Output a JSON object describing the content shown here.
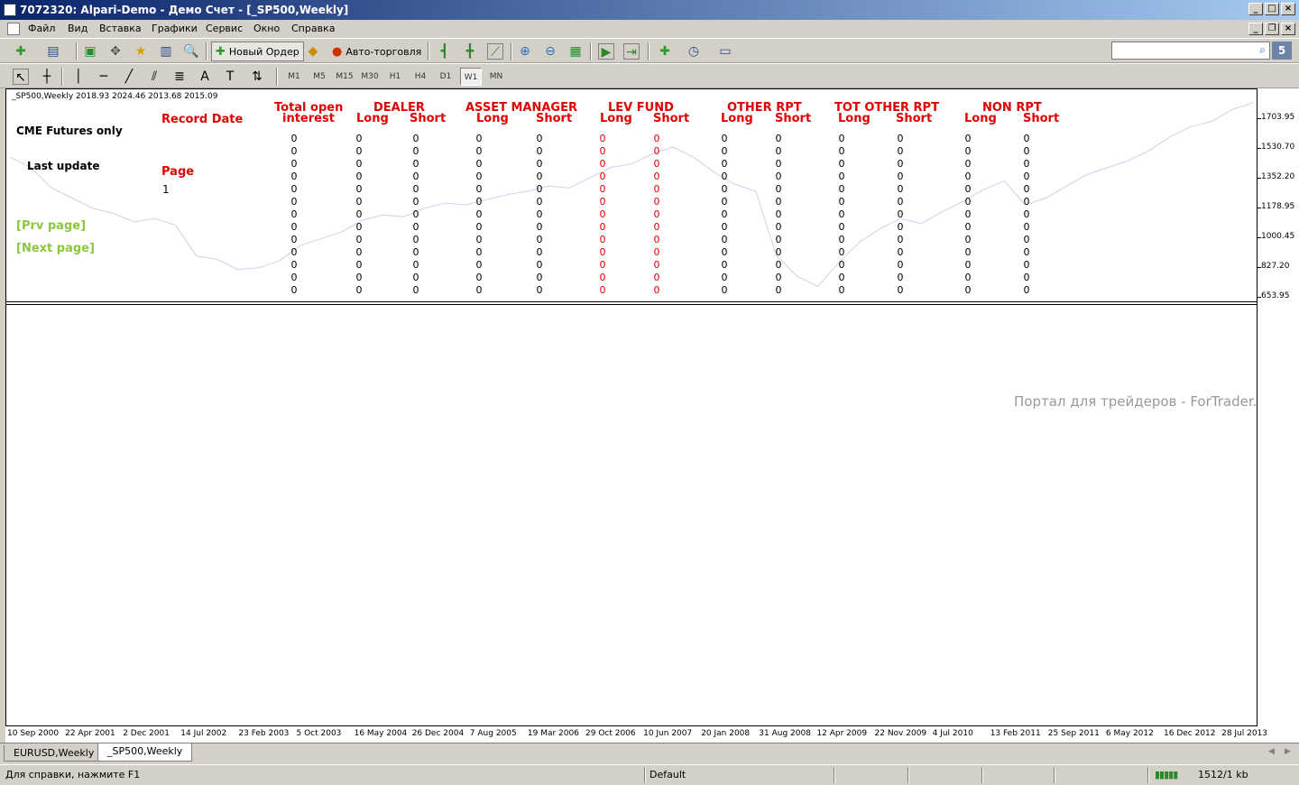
{
  "window": {
    "title": "7072320: Alpari-Demo - Демо Счет - [_SP500,Weekly]"
  },
  "menu": [
    "Файл",
    "Вид",
    "Вставка",
    "Графики",
    "Сервис",
    "Окно",
    "Справка"
  ],
  "toolbar": {
    "new_order": "Новый Ордер",
    "auto_trading": "Авто-торговля"
  },
  "periods": [
    "M1",
    "M5",
    "M15",
    "M30",
    "H1",
    "H4",
    "D1",
    "W1",
    "MN"
  ],
  "active_period": "W1",
  "chart": {
    "info": "_SP500,Weekly  2018.93 2024.46 2013.68 2015.09",
    "left_panel": {
      "source": "CME Futures only",
      "last_update": "Last update",
      "record_date": "Record  Date",
      "page_label": "Page",
      "page_value": "1",
      "prev": "[Prv page]",
      "next": "[Next page]"
    },
    "headers": {
      "total_open": "Total open",
      "interest": "interest",
      "dealer": "DEALER",
      "asset_manager": "ASSET MANAGER",
      "lev_fund": "LEV FUND",
      "other_rpt": "OTHER RPT",
      "tot_other_rpt": "TOT OTHER RPT",
      "non_rpt": "NON RPT",
      "long": "Long",
      "short": "Short"
    },
    "cell_value": "0",
    "rows": 13,
    "watermark": "Портал для трейдеров - ForTrader.ru"
  },
  "chart_data": {
    "type": "line",
    "title": "_SP500,Weekly",
    "y_ticks": [
      "1703.95",
      "1530.70",
      "1352.20",
      "1178.95",
      "1000.45",
      "827.20",
      "653.95"
    ],
    "x_ticks": [
      "10 Sep 2000",
      "22 Apr 2001",
      "2 Dec 2001",
      "14 Jul 2002",
      "23 Feb 2003",
      "5 Oct 2003",
      "16 May 2004",
      "26 Dec 2004",
      "7 Aug 2005",
      "19 Mar 2006",
      "29 Oct 2006",
      "10 Jun 2007",
      "20 Jan 2008",
      "31 Aug 2008",
      "12 Apr 2009",
      "22 Nov 2009",
      "4 Jul 2010",
      "13 Feb 2011",
      "25 Sep 2011",
      "6 May 2012",
      "16 Dec 2012",
      "28 Jul 2013"
    ],
    "ylim": [
      653.95,
      1800
    ],
    "series": [
      {
        "values": [
          1480,
          1420,
          1300,
          1240,
          1180,
          1150,
          1100,
          1120,
          1080,
          900,
          880,
          820,
          830,
          870,
          960,
          1000,
          1040,
          1110,
          1140,
          1130,
          1180,
          1210,
          1200,
          1230,
          1260,
          1280,
          1310,
          1300,
          1360,
          1420,
          1440,
          1500,
          1540,
          1480,
          1390,
          1320,
          1280,
          900,
          780,
          720,
          860,
          980,
          1060,
          1120,
          1090,
          1160,
          1220,
          1290,
          1340,
          1200,
          1240,
          1310,
          1380,
          1420,
          1460,
          1520,
          1600,
          1660,
          1690,
          1760,
          1800
        ]
      }
    ]
  },
  "tabs": [
    "EURUSD,Weekly",
    "_SP500,Weekly"
  ],
  "active_tab": "_SP500,Weekly",
  "status": {
    "help": "Для справки, нажмите F1",
    "profile": "Default",
    "traffic": "1512/1 kb"
  },
  "colors": {
    "header_red": "#e00000",
    "link_green": "#8cc63f",
    "price_line": "#c8d2e8"
  }
}
